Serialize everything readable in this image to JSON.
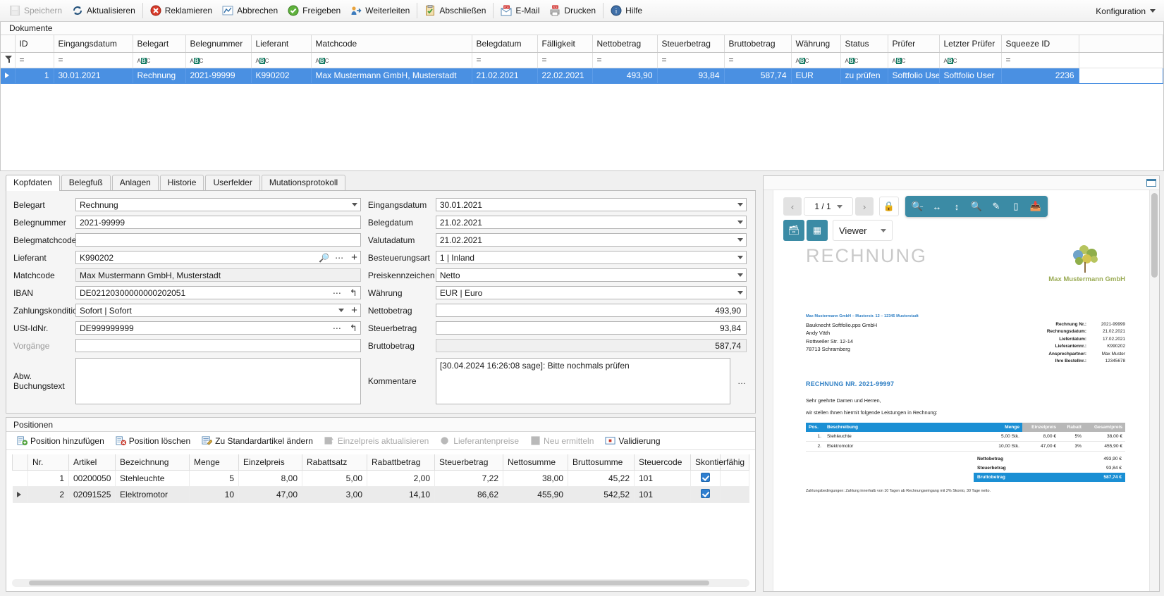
{
  "toolbar": {
    "buttons": [
      {
        "label": "Speichern",
        "icon": "save-icon",
        "disabled": true
      },
      {
        "label": "Aktualisieren",
        "icon": "refresh-icon",
        "disabled": false
      },
      {
        "label": "Reklamieren",
        "icon": "complaint-icon",
        "disabled": false
      },
      {
        "label": "Abbrechen",
        "icon": "cancel-icon",
        "disabled": false
      },
      {
        "label": "Freigeben",
        "icon": "approve-icon",
        "disabled": false
      },
      {
        "label": "Weiterleiten",
        "icon": "forward-icon",
        "disabled": false
      },
      {
        "label": "Abschließen",
        "icon": "complete-icon",
        "disabled": false
      },
      {
        "label": "E-Mail",
        "icon": "email-pdf-icon",
        "disabled": false
      },
      {
        "label": "Drucken",
        "icon": "print-pdf-icon",
        "disabled": false
      },
      {
        "label": "Hilfe",
        "icon": "help-icon",
        "disabled": false
      }
    ],
    "config_label": "Konfiguration"
  },
  "documents": {
    "caption": "Dokumente",
    "columns": [
      "ID",
      "Eingangsdatum",
      "Belegart",
      "Belegnummer",
      "Lieferant",
      "Matchcode",
      "Belegdatum",
      "Fälligkeit",
      "Nettobetrag",
      "Steuerbetrag",
      "Bruttobetrag",
      "Währung",
      "Status",
      "Prüfer",
      "Letzter Prüfer",
      "Squeeze ID"
    ],
    "filter_row": [
      "=",
      "=",
      "abc",
      "abc",
      "abc",
      "abc",
      "=",
      "=",
      "=",
      "=",
      "=",
      "abc",
      "abc",
      "abc",
      "abc",
      "="
    ],
    "rows": [
      {
        "ID": "1",
        "Eingangsdatum": "30.01.2021",
        "Belegart": "Rechnung",
        "Belegnummer": "2021-99999",
        "Lieferant": "K990202",
        "Matchcode": "Max Mustermann GmbH, Musterstadt",
        "Belegdatum": "21.02.2021",
        "Fälligkeit": "22.02.2021",
        "Nettobetrag": "493,90",
        "Steuerbetrag": "93,84",
        "Bruttobetrag": "587,74",
        "Währung": "EUR",
        "Status": "zu prüfen",
        "Prüfer": "Softfolio User",
        "LetzterPrüfer": "Softfolio User",
        "SqueezeID": "2236"
      }
    ]
  },
  "detail_tabs": [
    {
      "label": "Kopfdaten",
      "active": true
    },
    {
      "label": "Belegfuß",
      "active": false
    },
    {
      "label": "Anlagen",
      "active": false
    },
    {
      "label": "Historie",
      "active": false
    },
    {
      "label": "Userfelder",
      "active": false
    },
    {
      "label": "Mutationsprotokoll",
      "active": false
    }
  ],
  "form_left": [
    {
      "label": "Belegart",
      "value": "Rechnung",
      "icons": [
        "chevron-down"
      ],
      "readonly": false
    },
    {
      "label": "Belegnummer",
      "value": "2021-99999",
      "icons": [],
      "readonly": false
    },
    {
      "label": "Belegmatchcode",
      "value": "",
      "icons": [],
      "readonly": false
    },
    {
      "label": "Lieferant",
      "value": "K990202",
      "icons": [
        "search",
        "dots",
        "plus"
      ],
      "readonly": false
    },
    {
      "label": "Matchcode",
      "value": "Max Mustermann GmbH, Musterstadt",
      "icons": [],
      "readonly": true
    },
    {
      "label": "IBAN",
      "value": "DE02120300000000202051",
      "icons": [
        "dots",
        "undo"
      ],
      "readonly": false
    },
    {
      "label": "Zahlungskondition",
      "value": "Sofort | Sofort",
      "icons": [
        "chevron-down",
        "plus"
      ],
      "readonly": false
    },
    {
      "label": "USt-IdNr.",
      "value": "DE999999999",
      "icons": [
        "dots",
        "undo"
      ],
      "readonly": false
    },
    {
      "label": "Vorgänge",
      "value": "",
      "icons": [],
      "readonly": false,
      "label_dim": true
    }
  ],
  "form_left_textarea": {
    "label": "Abw. Buchungstext",
    "value": ""
  },
  "form_right": [
    {
      "label": "Eingangsdatum",
      "value": "30.01.2021",
      "icons": [
        "chevron-down"
      ],
      "align": "left"
    },
    {
      "label": "Belegdatum",
      "value": "21.02.2021",
      "icons": [
        "chevron-down"
      ],
      "align": "left"
    },
    {
      "label": "Valutadatum",
      "value": "21.02.2021",
      "icons": [
        "chevron-down"
      ],
      "align": "left"
    },
    {
      "label": "Besteuerungsart",
      "value": "1 | Inland",
      "icons": [
        "chevron-down"
      ],
      "align": "left"
    },
    {
      "label": "Preiskennzeichen",
      "value": "Netto",
      "icons": [
        "chevron-down"
      ],
      "align": "left"
    },
    {
      "label": "Währung",
      "value": "EUR | Euro",
      "icons": [
        "chevron-down"
      ],
      "align": "left"
    },
    {
      "label": "Nettobetrag",
      "value": "493,90",
      "icons": [],
      "align": "right"
    },
    {
      "label": "Steuerbetrag",
      "value": "93,84",
      "icons": [],
      "align": "right"
    },
    {
      "label": "Bruttobetrag",
      "value": "587,74",
      "icons": [],
      "align": "right",
      "readonly": true
    }
  ],
  "form_right_textarea": {
    "label": "Kommentare",
    "value": "[30.04.2024 16:26:08 sage]: Bitte nochmals prüfen",
    "dots": "…"
  },
  "positions": {
    "caption": "Positionen",
    "tools": [
      {
        "label": "Position hinzufügen",
        "icon": "add-row-icon",
        "disabled": false
      },
      {
        "label": "Position löschen",
        "icon": "delete-row-icon",
        "disabled": false
      },
      {
        "label": "Zu Standardartikel ändern",
        "icon": "standard-article-icon",
        "disabled": false
      },
      {
        "label": "Einzelpreis aktualisieren",
        "icon": "refresh-price-icon",
        "disabled": true
      },
      {
        "label": "Lieferantenpreise",
        "icon": "supplier-prices-icon",
        "disabled": true
      },
      {
        "label": "Neu ermitteln",
        "icon": "recalculate-icon",
        "disabled": true
      },
      {
        "label": "Validierung",
        "icon": "validation-icon",
        "disabled": false
      }
    ],
    "columns": [
      "Nr.",
      "Artikel",
      "Bezeichnung",
      "Menge",
      "Einzelpreis",
      "Rabattsatz",
      "Rabattbetrag",
      "Steuerbetrag",
      "Nettosumme",
      "Bruttosumme",
      "Steuercode",
      "Skontierfähig"
    ],
    "rows": [
      {
        "Nr": "1",
        "Artikel": "00200050",
        "Bezeichnung": "Stehleuchte",
        "Menge": "5",
        "Einzelpreis": "8,00",
        "Rabattsatz": "5,00",
        "Rabattbetrag": "2,00",
        "Steuerbetrag": "7,22",
        "Nettosumme": "38,00",
        "Bruttosumme": "45,22",
        "Steuercode": "101",
        "Skontierfähig": true,
        "selected": false
      },
      {
        "Nr": "2",
        "Artikel": "02091525",
        "Bezeichnung": "Elektromotor",
        "Menge": "10",
        "Einzelpreis": "47,00",
        "Rabattsatz": "3,00",
        "Rabattbetrag": "14,10",
        "Steuerbetrag": "86,62",
        "Nettosumme": "455,90",
        "Bruttosumme": "542,52",
        "Steuercode": "101",
        "Skontierfähig": true,
        "selected": true
      }
    ]
  },
  "viewer": {
    "page_indicator": "1 / 1",
    "mode_label": "Viewer",
    "buttons": {
      "prev": "‹",
      "next": "›",
      "lock": "lock-icon",
      "zoom_out": "zoom-out-icon",
      "fit_width": "fit-width-icon",
      "fit_height": "fit-height-icon",
      "zoom_in": "zoom-in-icon",
      "annotate": "pen-icon",
      "stamp": "stamp-icon",
      "save_doc": "save-doc-icon",
      "compare": "compare-icon",
      "thumbnails": "thumbnails-icon"
    }
  },
  "invoice": {
    "watermark_title": "RECHNUNG",
    "logo_company": "Max Mustermann GmbH",
    "sender_line": "Max Mustermann GmbH – Musterstr. 12 – 12345 Musterstadt",
    "recipient": [
      "Bauknecht Softfolio.pps GmbH",
      "Andy Väth",
      "Rottweiler Str. 12-14",
      "78713 Schramberg"
    ],
    "meta": [
      {
        "key": "Rechnung Nr.:",
        "value": "2021-99999"
      },
      {
        "key": "Rechnungsdatum:",
        "value": "21.02.2021"
      },
      {
        "key": "Lieferdatum:",
        "value": "17.02.2021"
      },
      {
        "key": "Lieferantennr.:",
        "value": "K990202"
      },
      {
        "key": "Ansprechpartner:",
        "value": "Max Muster"
      },
      {
        "key": "Ihre Bestellnr.:",
        "value": "12345678"
      }
    ],
    "heading": "RECHNUNG NR. 2021-99997",
    "salutation": "Sehr geehrte Damen und Herren,",
    "intro": "wir stellen Ihnen hiermit folgende Leistungen in Rechnung:",
    "table_head": [
      "Pos.",
      "Beschreibung",
      "Menge",
      "Einzelpreis",
      "Rabatt",
      "Gesamtpreis"
    ],
    "table_rows": [
      {
        "pos": "1.",
        "desc": "Stehleuchte",
        "menge": "5,00 Stk.",
        "einzel": "8,00 €",
        "rabatt": "5%",
        "gesamt": "38,00 €"
      },
      {
        "pos": "2.",
        "desc": "Elektromotor",
        "menge": "10,00 Stk.",
        "einzel": "47,00 €",
        "rabatt": "3%",
        "gesamt": "455,90 €"
      }
    ],
    "totals": [
      {
        "key": "Nettobetrag",
        "value": "493,90 €",
        "highlight": false
      },
      {
        "key": "Steuerbetrag",
        "value": "93,84 €",
        "highlight": false
      },
      {
        "key": "Bruttobetrag",
        "value": "587,74 €",
        "highlight": true
      }
    ],
    "footer": "Zahlungsbedingungen: Zahlung innerhalb von 10 Tagen ab Rechnungseingang mit 2% Skonto, 30 Tage netto."
  },
  "colors": {
    "selection_blue": "#4a90e2",
    "teal": "#3b8ba5",
    "invoice_blue": "#1a8fd4",
    "logo_green": "#9aab54"
  }
}
